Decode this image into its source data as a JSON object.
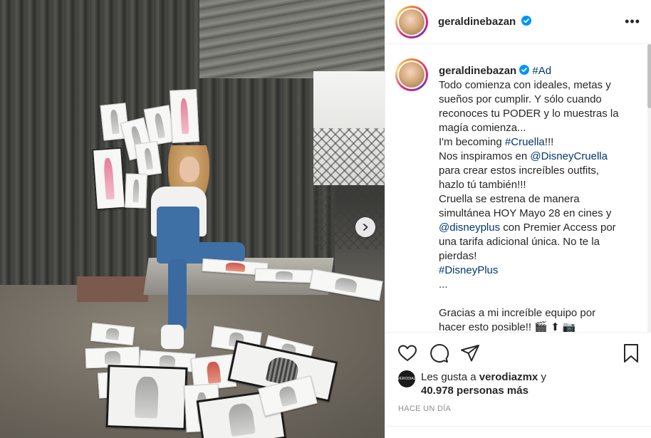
{
  "post": {
    "username": "geraldinebazan",
    "more_label": "•••",
    "timestamp": "HACE UN DÍA"
  },
  "caption": {
    "username": "geraldinebazan",
    "ad_tag": "#Ad",
    "line1": "Todo comienza con ideales, metas y",
    "line2": "sueños por cumplir. Y sólo cuando",
    "line3": "reconoces tu PODER y lo muestras la",
    "line4": "magía comienza...",
    "line5_prefix": "I'm becoming ",
    "line5_tag": "#Cruella",
    "line5_suffix": "!!!",
    "line6_prefix": "Nos inspiramos en ",
    "line6_mention": "@DisneyCruella",
    "line7": "para crear estos increíbles outfits,",
    "line8": "hazlo tú también!!!",
    "line9": "Cruella se estrena de manera",
    "line10": "simultánea HOY Mayo 28 en cines y",
    "line11_mention": "@disneyplus",
    "line11_suffix": " con Premier Access por",
    "line12": "una tarifa adicional única. No te la",
    "line13": "pierdas!",
    "line14_tag": "#DisneyPlus",
    "line15": "...",
    "line16": "Gracias a mi increíble equipo por",
    "line17": "hacer esto posible!! 🎬 ⬆ 📷"
  },
  "likes": {
    "avatar_text": "VERODIAZ",
    "prefix": "Les gusta a ",
    "user": "verodiazmx",
    "suffix": " y",
    "count": "40.978 personas más"
  },
  "colors": {
    "text": "#262626",
    "link": "#00376b",
    "verified": "#0095f6",
    "muted": "#8e8e8e"
  },
  "icons": {
    "like": "heart-icon",
    "comment": "comment-icon",
    "share": "paper-plane-icon",
    "save": "bookmark-icon",
    "carousel": "chevron-right-icon"
  }
}
